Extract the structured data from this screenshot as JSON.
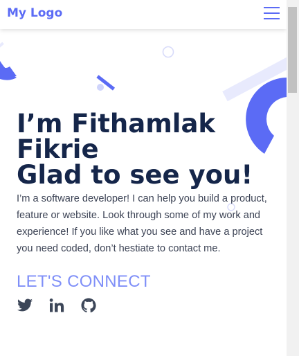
{
  "navbar": {
    "logo": "My Logo",
    "menu_icon": "hamburger-menu-icon"
  },
  "hero": {
    "heading_lines": [
      "I’m Fithamlak",
      "Fikrie",
      "Glad to see you!"
    ],
    "bio": "I’m a software developer! I can help you build a product, feature or website. Look through some of my work and experience! If you like what you see and have a project you need coded, don’t hestiate to contact me.",
    "connect_label": "LET'S CONNECT"
  },
  "socials": [
    {
      "icon": "twitter-icon"
    },
    {
      "icon": "linkedin-icon"
    },
    {
      "icon": "github-icon"
    }
  ],
  "colors": {
    "accent": "#5b6bf5",
    "accent_light": "#7f8ff8",
    "heading": "#15264a",
    "body_text": "#3b4254",
    "decor_light": "#e8eafd",
    "social_icon": "#3c4658"
  }
}
